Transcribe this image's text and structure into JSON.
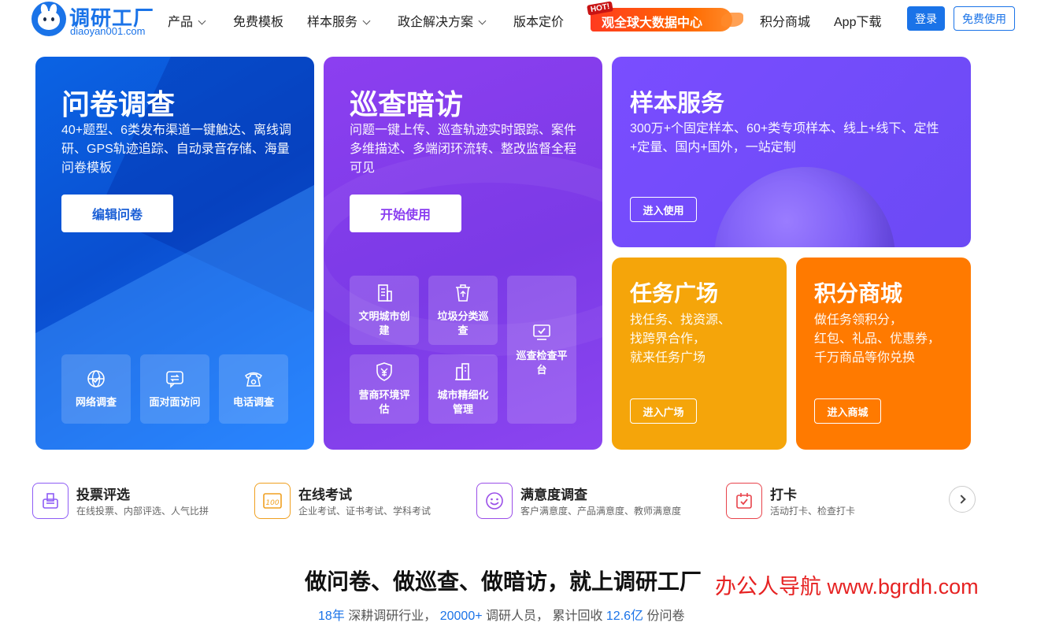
{
  "nav": {
    "logo_name": "调研工厂",
    "logo_domain": "diaoyan001.com",
    "items": [
      {
        "label": "产品",
        "has_dropdown": true
      },
      {
        "label": "免费模板",
        "has_dropdown": false
      },
      {
        "label": "样本服务",
        "has_dropdown": true
      },
      {
        "label": "政企解决方案",
        "has_dropdown": true
      },
      {
        "label": "版本定价",
        "has_dropdown": false
      }
    ],
    "hot_tag": "HOT!",
    "hot_banner": "观全球大数据中心",
    "points_mall": "积分商城",
    "app_download": "App下载",
    "login": "登录",
    "free_use": "免费使用"
  },
  "cards": {
    "survey": {
      "title": "问卷调查",
      "desc": "40+题型、6类发布渠道一键触达、离线调研、GPS轨迹追踪、自动录音存储、海量问卷模板",
      "button": "编辑问卷",
      "tiles": [
        {
          "label": "网络调查",
          "icon": "globe-check-icon"
        },
        {
          "label": "面对面访问",
          "icon": "chat-exchange-icon"
        },
        {
          "label": "电话调查",
          "icon": "telephone-icon"
        }
      ]
    },
    "inspection": {
      "title": "巡查暗访",
      "desc": "问题一键上传、巡查轨迹实时跟踪、案件多维描述、多端闭环流转、整改监督全程可见",
      "button": "开始使用",
      "tiles": [
        {
          "label": "文明城市创建",
          "icon": "building-icon"
        },
        {
          "label": "垃圾分类巡查",
          "icon": "trash-bin-icon"
        },
        {
          "label": "巡查检查平台",
          "icon": "monitor-check-icon"
        },
        {
          "label": "营商环境评估",
          "icon": "shield-yen-icon"
        },
        {
          "label": "城市精细化管理",
          "icon": "city-buildings-icon"
        }
      ]
    },
    "sample": {
      "title": "样本服务",
      "desc": "300万+个固定样本、60+类专项样本、线上+线下、定性+定量、国内+国外，一站定制",
      "button": "进入使用"
    },
    "task": {
      "title": "任务广场",
      "desc_lines": [
        "找任务、找资源、",
        "找跨界合作，",
        "就来任务广场"
      ],
      "button": "进入广场"
    },
    "mall": {
      "title": "积分商城",
      "desc_lines": [
        "做任务领积分，",
        "红包、礼品、优惠券，",
        "千万商品等你兑换"
      ],
      "button": "进入商城"
    }
  },
  "features": [
    {
      "title": "投票评选",
      "desc": "在线投票、内部评选、人气比拼",
      "icon": "ballot-box-icon",
      "color": "#8e5cf5"
    },
    {
      "title": "在线考试",
      "desc": "企业考试、证书考试、学科考试",
      "icon": "exam-score-icon",
      "color": "#f0a020"
    },
    {
      "title": "满意度调查",
      "desc": "客户满意度、产品满意度、教师满意度",
      "icon": "smiley-icon",
      "color": "#9a4ee8"
    },
    {
      "title": "打卡",
      "desc": "活动打卡、检查打卡",
      "icon": "calendar-check-icon",
      "color": "#e8434b"
    }
  ],
  "slogan": "做问卷、做巡查、做暗访，就上调研工厂",
  "watermark": "办公人导航 www.bgrdh.com",
  "stats": {
    "years": "18年",
    "years_text": " 深耕调研行业，  ",
    "people": "20000+",
    "people_text": " 调研人员，  累计回收 ",
    "count": "12.6亿",
    "count_text": " 份问卷"
  },
  "colors": {
    "brand": "#1a73e8",
    "survey": "#0b63e4",
    "inspection": "#8c3ff0",
    "sample": "#7a4dff",
    "task": "#f5a50a",
    "mall": "#ff7a00"
  }
}
